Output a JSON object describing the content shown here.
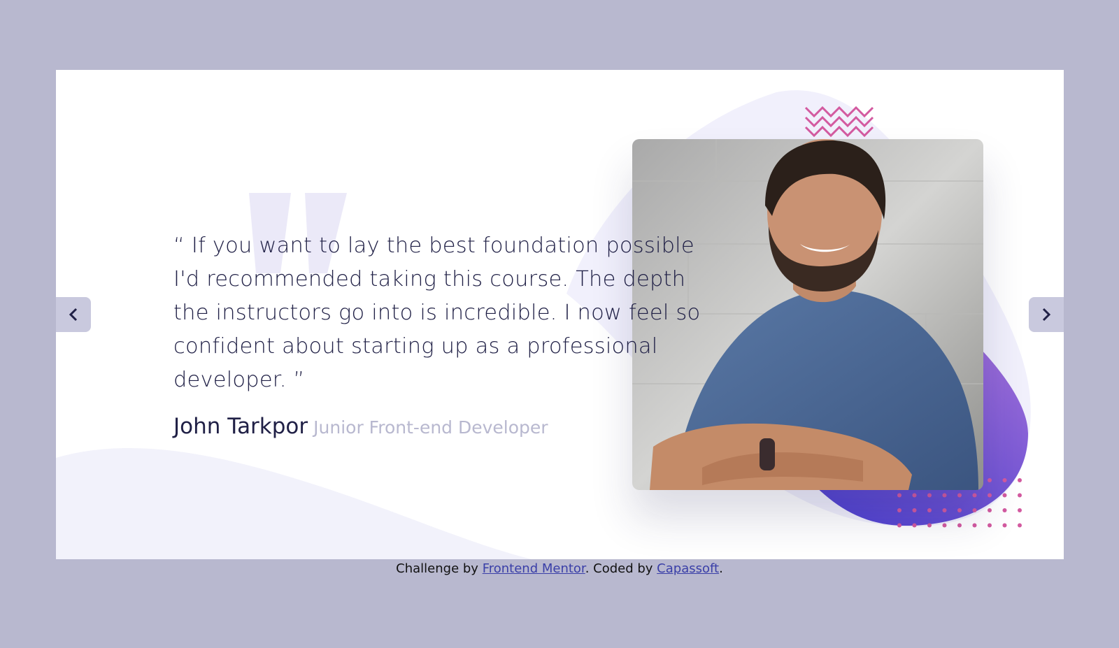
{
  "testimonial": {
    "quote": "“ If you want to lay the best foundation possible I'd recommended taking this course. The depth the instructors go into is incredible. I now feel so confident about starting up as a professional developer. ”",
    "author_name": "John Tarkpor",
    "author_role": "Junior Front-end Developer"
  },
  "navigation": {
    "prev_icon": "chevron-left-icon",
    "next_icon": "chevron-right-icon"
  },
  "attribution": {
    "prefix": "Challenge by ",
    "link1": "Frontend Mentor",
    "middle": ". Coded by ",
    "link2": "Capassoft",
    "suffix": "."
  },
  "colors": {
    "page_bg": "#b8b8cf",
    "text_dark": "#202046",
    "text_muted": "#b8b8cf",
    "accent_purple": "#5648d6",
    "accent_pink": "#d35aa0"
  }
}
